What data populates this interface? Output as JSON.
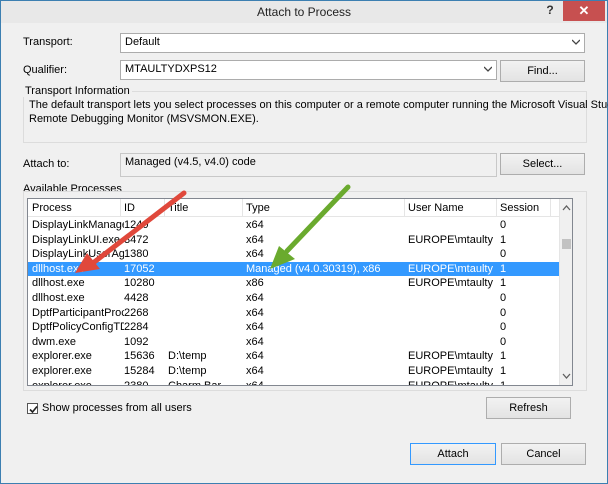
{
  "window": {
    "title": "Attach to Process",
    "help": "?",
    "close": "✕"
  },
  "transport": {
    "label": "Transport:",
    "value": "Default"
  },
  "qualifier": {
    "label": "Qualifier:",
    "value": "MTAULTYDXPS12",
    "find_label": "Find..."
  },
  "transport_info": {
    "title": "Transport Information",
    "text_line1": "The default transport lets you select processes on this computer or a remote computer running the Microsoft Visual Studio",
    "text_line2": "Remote Debugging Monitor (MSVSMON.EXE)."
  },
  "attach_to": {
    "label": "Attach to:",
    "value": "Managed (v4.5, v4.0) code",
    "select_label": "Select..."
  },
  "processes": {
    "title": "Available Processes",
    "columns": {
      "process": "Process",
      "id": "ID",
      "title": "Title",
      "type": "Type",
      "user": "User Name",
      "session": "Session"
    },
    "rows": [
      {
        "process": "DisplayLinkManage...",
        "id": "1240",
        "title": "",
        "type": "x64",
        "user": "",
        "session": "0"
      },
      {
        "process": "DisplayLinkUI.exe",
        "id": "3472",
        "title": "",
        "type": "x64",
        "user": "EUROPE\\mtaulty",
        "session": "1"
      },
      {
        "process": "DisplayLinkUserAge...",
        "id": "1380",
        "title": "",
        "type": "x64",
        "user": "",
        "session": "0"
      },
      {
        "process": "dllhost.exe",
        "id": "17052",
        "title": "",
        "type": "Managed (v4.0.30319), x86",
        "user": "EUROPE\\mtaulty",
        "session": "1",
        "selected": true
      },
      {
        "process": "dllhost.exe",
        "id": "10280",
        "title": "",
        "type": "x86",
        "user": "EUROPE\\mtaulty",
        "session": "1"
      },
      {
        "process": "dllhost.exe",
        "id": "4428",
        "title": "",
        "type": "x64",
        "user": "",
        "session": "0"
      },
      {
        "process": "DptfParticipantProc...",
        "id": "2268",
        "title": "",
        "type": "x64",
        "user": "",
        "session": "0"
      },
      {
        "process": "DptfPolicyConfigTD...",
        "id": "2284",
        "title": "",
        "type": "x64",
        "user": "",
        "session": "0"
      },
      {
        "process": "dwm.exe",
        "id": "1092",
        "title": "",
        "type": "x64",
        "user": "",
        "session": "0"
      },
      {
        "process": "explorer.exe",
        "id": "15636",
        "title": "D:\\temp",
        "type": "x64",
        "user": "EUROPE\\mtaulty",
        "session": "1"
      },
      {
        "process": "explorer.exe",
        "id": "15284",
        "title": "D:\\temp",
        "type": "x64",
        "user": "EUROPE\\mtaulty",
        "session": "1"
      },
      {
        "process": "explorer.exe",
        "id": "2380",
        "title": "Charm Bar",
        "type": "x64",
        "user": "EUROPE\\mtaulty",
        "session": "1"
      }
    ]
  },
  "show_all": {
    "label": "Show processes from all users",
    "checked": true
  },
  "buttons": {
    "refresh": "Refresh",
    "attach": "Attach",
    "cancel": "Cancel"
  },
  "annotations": {
    "red_arrow_color": "#e0483b",
    "green_arrow_color": "#6aaa2e"
  }
}
